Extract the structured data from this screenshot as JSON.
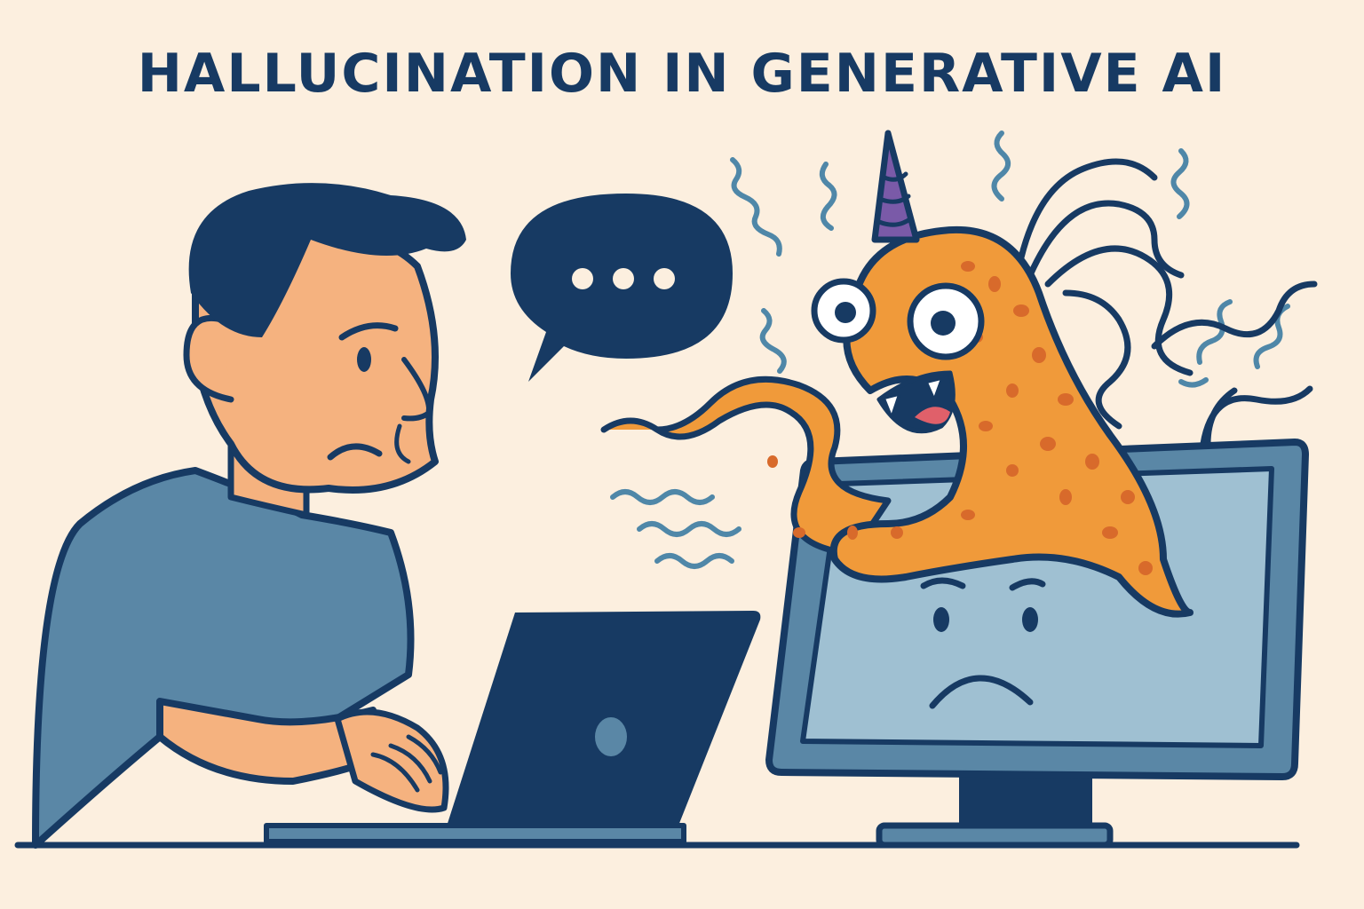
{
  "title": "HALLUCINATION IN GENERATIVE AI",
  "colors": {
    "background": "#fcefdf",
    "ink": "#173a63",
    "skin": "#f5b27f",
    "shirt": "#5a87a6",
    "monster": "#f09a3a",
    "monster_spots": "#d86a2b",
    "horn": "#7a5aa8",
    "screen": "#9fc0d2",
    "squiggles": "#4f87a8"
  },
  "scene": {
    "person": "worried person at laptop",
    "speech_bubble": "ellipsis speech bubble",
    "monster": "one-horned orange tentacle monster",
    "monitor": "sad-faced monitor"
  }
}
